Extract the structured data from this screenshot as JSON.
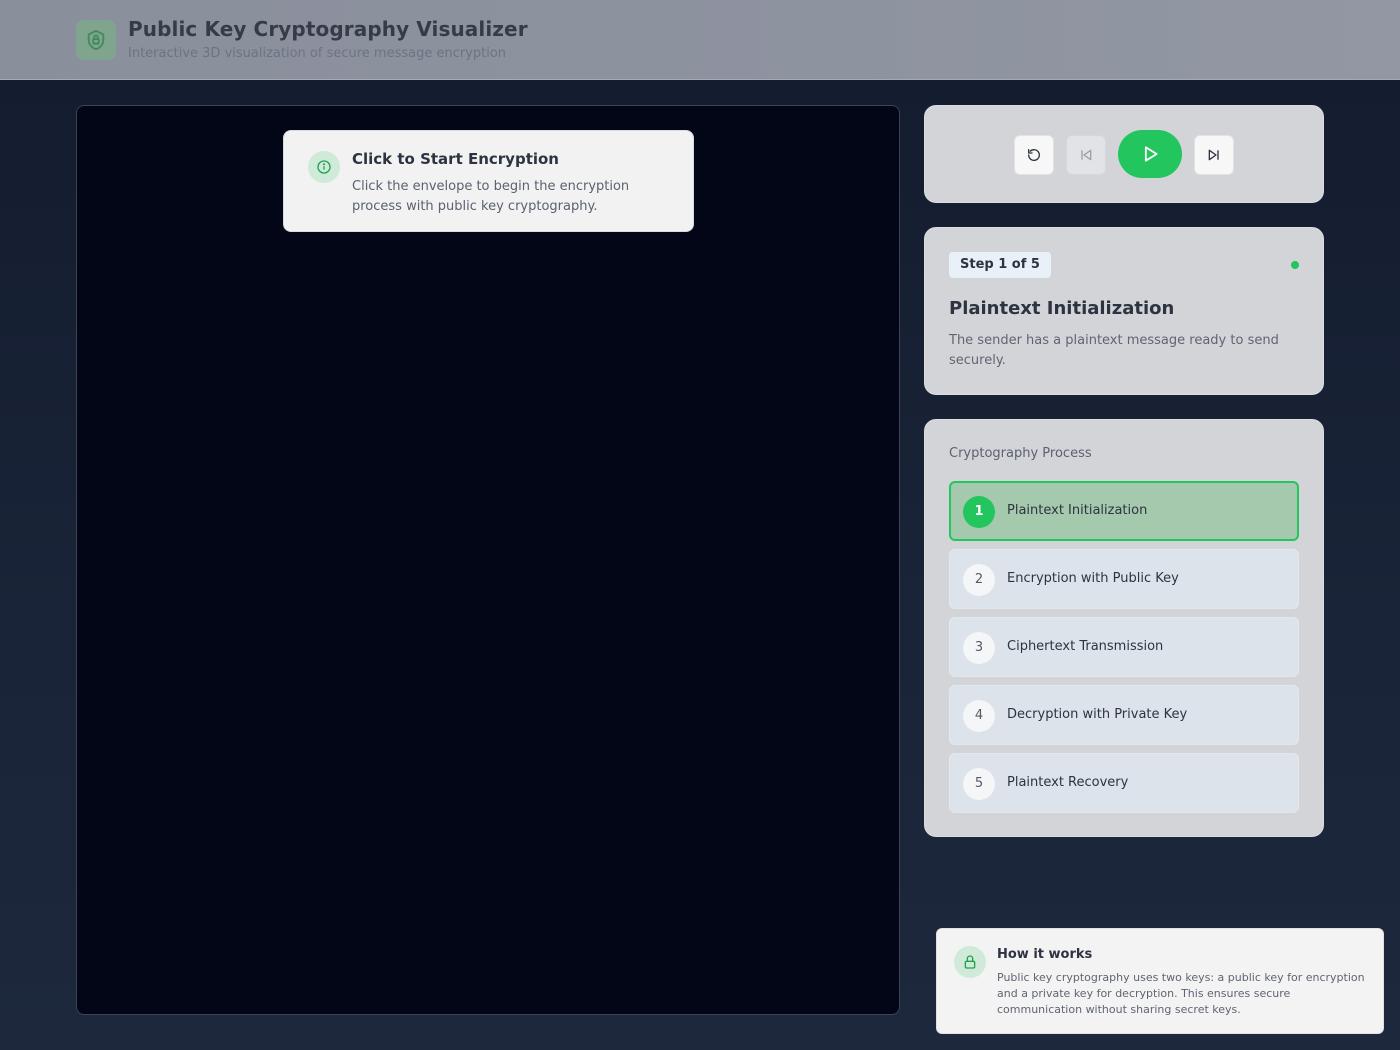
{
  "header": {
    "title": "Public Key Cryptography Visualizer",
    "subtitle": "Interactive 3D visualization of secure message encryption",
    "logo_icon": "shield-icon"
  },
  "viewport": {
    "hint_title": "Click to Start Encryption",
    "hint_text": "Click the envelope to begin the encryption process with public key cryptography.",
    "hint_icon": "info-icon"
  },
  "controls": {
    "reset_icon": "reset-icon",
    "prev_icon": "skip-back-icon",
    "play_icon": "play-icon",
    "next_icon": "skip-forward-icon"
  },
  "step": {
    "badge": "Step 1 of 5",
    "title": "Plaintext Initialization",
    "description": "The sender has a plaintext message ready to send securely.",
    "status_color": "#22c55e"
  },
  "process": {
    "heading": "Cryptography Process",
    "items": [
      {
        "num": "1",
        "label": "Plaintext Initialization"
      },
      {
        "num": "2",
        "label": "Encryption with Public Key"
      },
      {
        "num": "3",
        "label": "Ciphertext Transmission"
      },
      {
        "num": "4",
        "label": "Decryption with Private Key"
      },
      {
        "num": "5",
        "label": "Plaintext Recovery"
      }
    ],
    "active_index": 0
  },
  "how_it_works": {
    "title": "How it works",
    "text": "Public key cryptography uses two keys: a public key for encryption and a private key for decryption. This ensures secure communication without sharing secret keys.",
    "icon": "lock-icon"
  },
  "colors": {
    "accent": "#22c55e",
    "viewport_bg": "#030616",
    "page_bg": "#131c2e"
  }
}
